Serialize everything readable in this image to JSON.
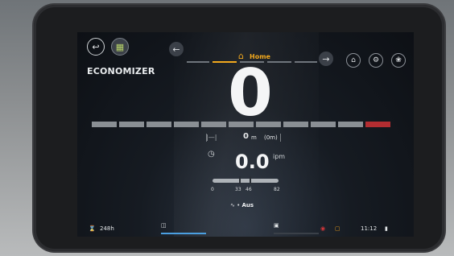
{
  "top": {
    "home_label": "Home",
    "back_icon": "back-icon",
    "vehicle_icon": "vehicle-icon",
    "tabs_total": 5,
    "active_tab_index": 1,
    "right_icons": [
      "home-icon",
      "engine-icon",
      "fan-icon"
    ]
  },
  "main": {
    "mode_label": "ECONOMIZER",
    "big_value": "0",
    "segments_total": 11,
    "segments_red": 1,
    "distance": {
      "value": "0",
      "unit": "m",
      "secondary": "(0m)"
    },
    "rate": {
      "value": "0.0",
      "unit": "ipm"
    },
    "scale": {
      "min": "0",
      "mark1": "33",
      "mark2": "46",
      "max": "82"
    },
    "aus_label": "Aus"
  },
  "status": {
    "hours": "248h",
    "time": "11:12"
  },
  "colors": {
    "accent": "#f2a81d",
    "warning_red": "#d4373b"
  }
}
